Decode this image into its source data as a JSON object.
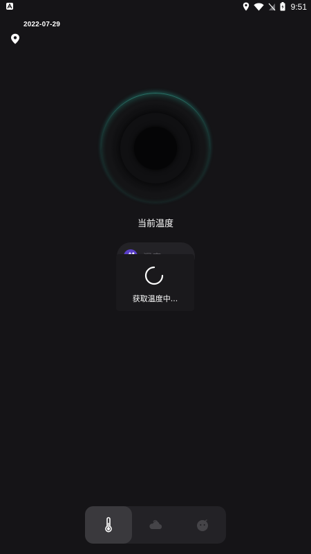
{
  "status_bar": {
    "app_icon": "a-icon",
    "time": "9:51",
    "icons": [
      "location-icon",
      "wifi-icon",
      "no-sim-icon",
      "battery-charging-icon"
    ]
  },
  "header": {
    "date": "2022-07-29",
    "location_icon": "location-pin-icon"
  },
  "gauge": {
    "label": "当前温度"
  },
  "humidity": {
    "icon": "water-drop-icon",
    "label": "湿度"
  },
  "loading": {
    "text": "获取温度中..."
  },
  "bottom_nav": {
    "items": [
      {
        "icon": "thermometer-icon",
        "active": true
      },
      {
        "icon": "cloud-icon",
        "active": false
      },
      {
        "icon": "face-icon",
        "active": false
      }
    ]
  },
  "colors": {
    "background": "#151417",
    "accent_teal": "#2fbfa8",
    "humidity_icon_bg": "#5a3fc8",
    "pill_bg": "#232226"
  }
}
